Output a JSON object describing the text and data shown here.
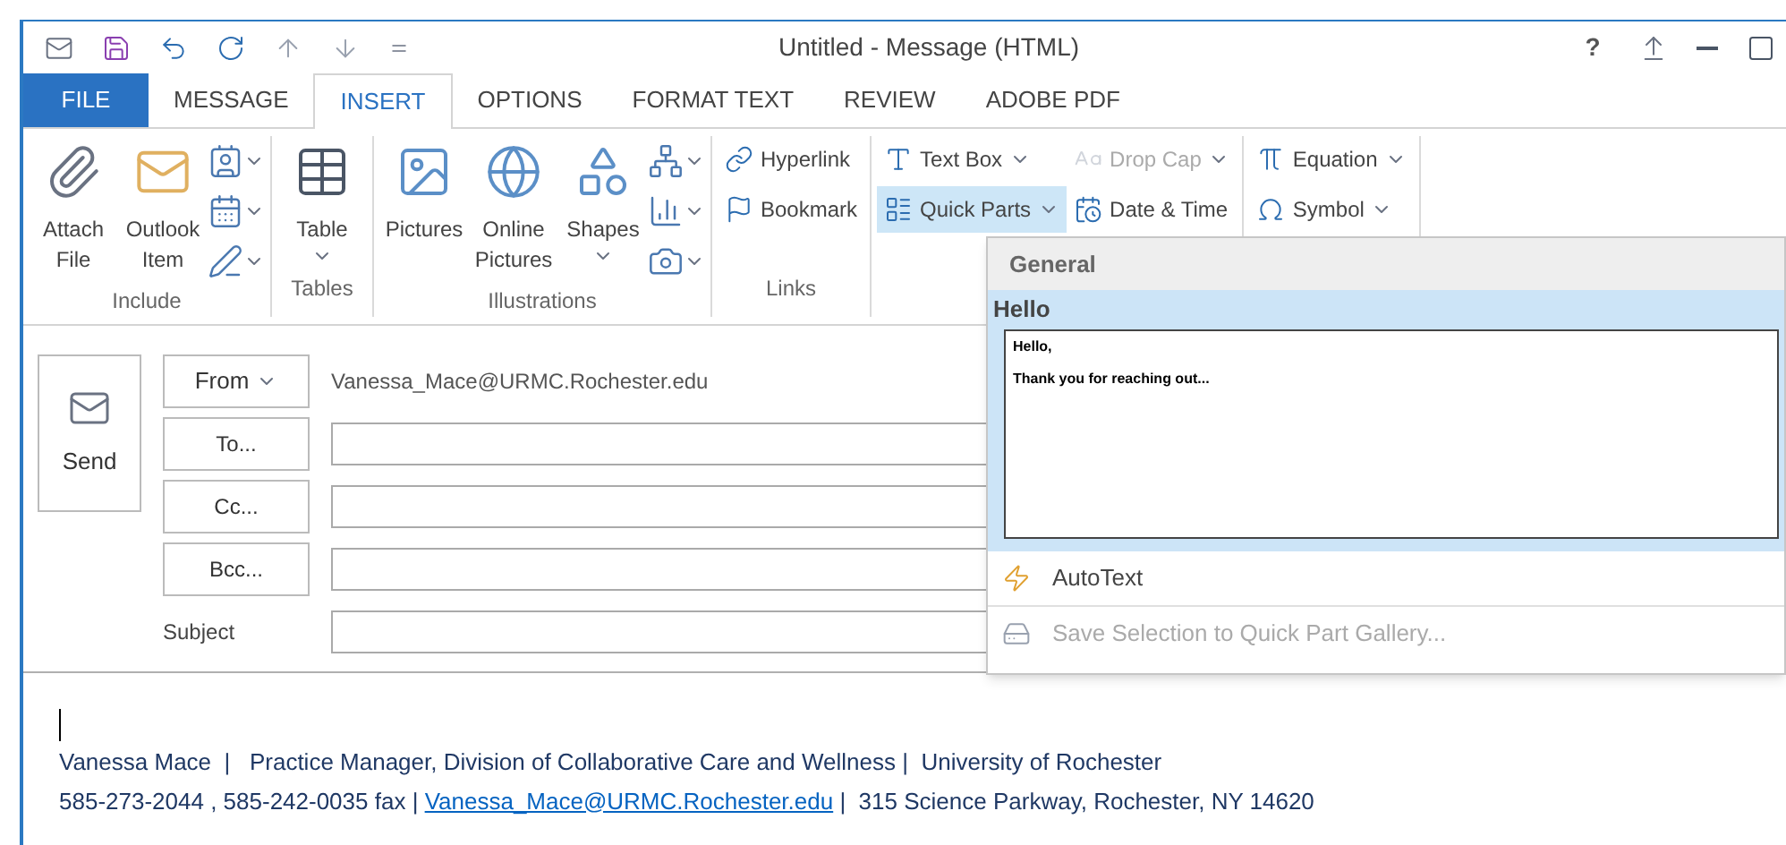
{
  "window": {
    "title": "Untitled - Message (HTML)",
    "help": "?"
  },
  "tabs": [
    {
      "label": "FILE",
      "selected": false,
      "kind": "file"
    },
    {
      "label": "MESSAGE",
      "selected": false,
      "kind": "tab"
    },
    {
      "label": "INSERT",
      "selected": true,
      "kind": "tab"
    },
    {
      "label": "OPTIONS",
      "selected": false,
      "kind": "tab"
    },
    {
      "label": "FORMAT TEXT",
      "selected": false,
      "kind": "tab"
    },
    {
      "label": "REVIEW",
      "selected": false,
      "kind": "tab"
    },
    {
      "label": "ADOBE PDF",
      "selected": false,
      "kind": "tab"
    }
  ],
  "ribbon": [
    {
      "label": "Include",
      "items": [
        {
          "kind": "large",
          "label": "Attach File"
        },
        {
          "kind": "large",
          "label": "Outlook Item"
        },
        {
          "kind": "stack"
        }
      ]
    },
    {
      "label": "Tables",
      "items": [
        {
          "kind": "large",
          "label": "Table",
          "dropdown": true
        }
      ]
    },
    {
      "label": "Illustrations",
      "items": [
        {
          "kind": "large",
          "label": "Pictures"
        },
        {
          "kind": "large",
          "label": "Online Pictures"
        },
        {
          "kind": "large",
          "label": "Shapes",
          "dropdown": true
        },
        {
          "kind": "stack"
        }
      ]
    },
    {
      "label": "Links",
      "items": [
        {
          "kind": "small",
          "label": "Hyperlink",
          "dropdown": false,
          "disabled": false,
          "pressed": false
        },
        {
          "kind": "small",
          "label": "Bookmark",
          "dropdown": false,
          "disabled": false,
          "pressed": false
        }
      ]
    },
    {
      "items": [
        {
          "kind": "small",
          "label": "Text Box",
          "dropdown": true,
          "disabled": false,
          "pressed": false
        },
        {
          "kind": "small",
          "label": "Quick Parts",
          "dropdown": true,
          "disabled": false,
          "pressed": true
        },
        {
          "kind": "small",
          "label": "Drop Cap",
          "dropdown": true,
          "disabled": true,
          "pressed": false
        },
        {
          "kind": "small",
          "label": "Date & Time",
          "dropdown": false,
          "disabled": false,
          "pressed": false
        }
      ]
    },
    {
      "items": [
        {
          "kind": "small",
          "label": "Equation",
          "dropdown": true,
          "disabled": false,
          "pressed": false
        },
        {
          "kind": "small",
          "label": "Symbol",
          "dropdown": true,
          "disabled": false,
          "pressed": false
        }
      ]
    }
  ],
  "compose": {
    "send": "Send",
    "from_button": "From",
    "from_value": "Vanessa_Mace@URMC.Rochester.edu",
    "recipients": [
      "To...",
      "Cc...",
      "Bcc..."
    ],
    "subject_label": "Subject"
  },
  "quick_parts_menu": {
    "header": "General",
    "entries": [
      {
        "name": "Hello",
        "selected": true,
        "preview": [
          "Hello,",
          "Thank you for reaching out..."
        ]
      }
    ],
    "items": [
      {
        "label": "AutoText",
        "disabled": false
      },
      {
        "label": "Save Selection to Quick Part Gallery...",
        "disabled": true
      }
    ]
  },
  "signature": {
    "line_1": "Vanessa Mace  |   Practice Manager, Division of Collaborative Care and Wellness |  University of Rochester",
    "line_2_before": "585-273-2044 , 585-242-0035 fax | ",
    "link": "Vanessa_Mace@URMC.Rochester.edu",
    "line_2_after": " |  315 Science Parkway, Rochester, NY 14620"
  }
}
